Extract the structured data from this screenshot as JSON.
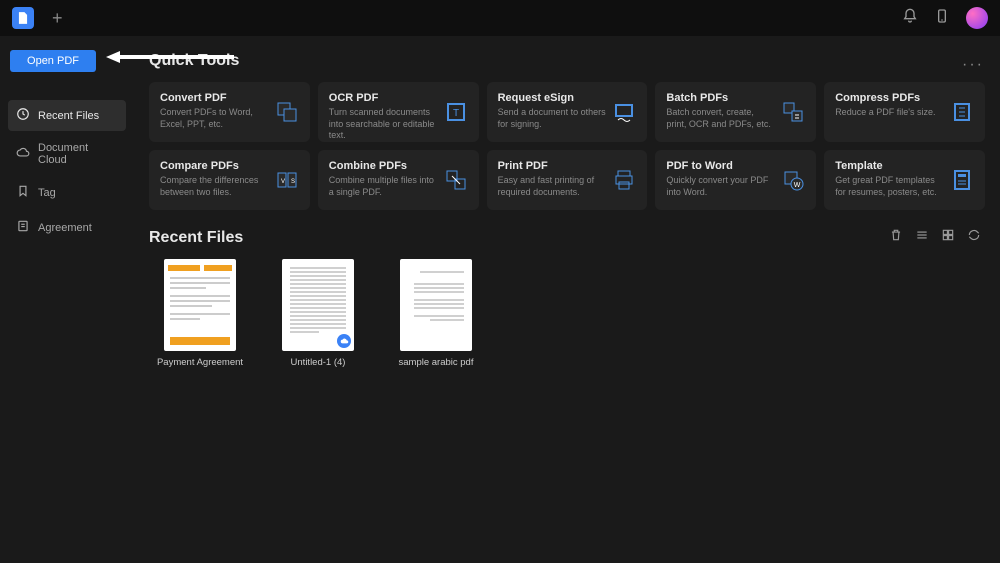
{
  "sidebar": {
    "open_pdf": "Open PDF",
    "items": [
      {
        "label": "Recent Files"
      },
      {
        "label": "Document Cloud"
      },
      {
        "label": "Tag"
      },
      {
        "label": "Agreement"
      }
    ]
  },
  "quick_tools": {
    "title": "Quick Tools",
    "tools": [
      {
        "title": "Convert PDF",
        "desc": "Convert PDFs to Word, Excel, PPT, etc."
      },
      {
        "title": "OCR PDF",
        "desc": "Turn scanned documents into searchable or editable text."
      },
      {
        "title": "Request eSign",
        "desc": "Send a document to others for signing."
      },
      {
        "title": "Batch PDFs",
        "desc": "Batch convert, create, print, OCR and PDFs, etc."
      },
      {
        "title": "Compress PDFs",
        "desc": "Reduce a PDF file's size."
      },
      {
        "title": "Compare PDFs",
        "desc": "Compare the differences between two files."
      },
      {
        "title": "Combine PDFs",
        "desc": "Combine multiple files into a single PDF."
      },
      {
        "title": "Print PDF",
        "desc": "Easy and fast printing of required documents."
      },
      {
        "title": "PDF to Word",
        "desc": "Quickly convert your PDF into Word."
      },
      {
        "title": "Template",
        "desc": "Get great PDF templates for resumes, posters, etc."
      }
    ]
  },
  "recent": {
    "title": "Recent Files",
    "files": [
      {
        "name": "Payment Agreement"
      },
      {
        "name": "Untitled-1 (4)"
      },
      {
        "name": "sample arabic pdf"
      }
    ]
  },
  "colors": {
    "accent": "#3b82f6",
    "card": "#232323",
    "bg": "#1a1a1a"
  }
}
